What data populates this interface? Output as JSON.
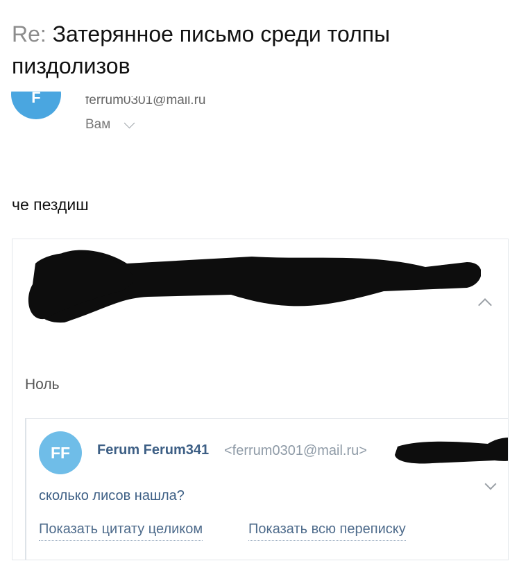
{
  "message": {
    "subject_prefix": "Re:",
    "subject": "Затерянное письмо среди толпы пиздолизов",
    "sender_email": "ferrum0301@mail.ru",
    "recipient_label": "Вам",
    "body": "че пездиш"
  },
  "quote": {
    "name_visible": "Ноль",
    "inner": {
      "avatar_initials": "FF",
      "author_name": "Ferum Ferum341",
      "author_email": "<ferrum0301@mail.ru>",
      "text": "сколько лисов нашла?",
      "show_full_quote": "Показать цитату целиком",
      "show_full_thread": "Показать всю переписку"
    }
  },
  "colors": {
    "avatar_blue": "#4aa6e0",
    "ff_avatar_blue": "#6fbde8",
    "link_color": "#4f6c8c",
    "author_color": "#3d5f85"
  }
}
